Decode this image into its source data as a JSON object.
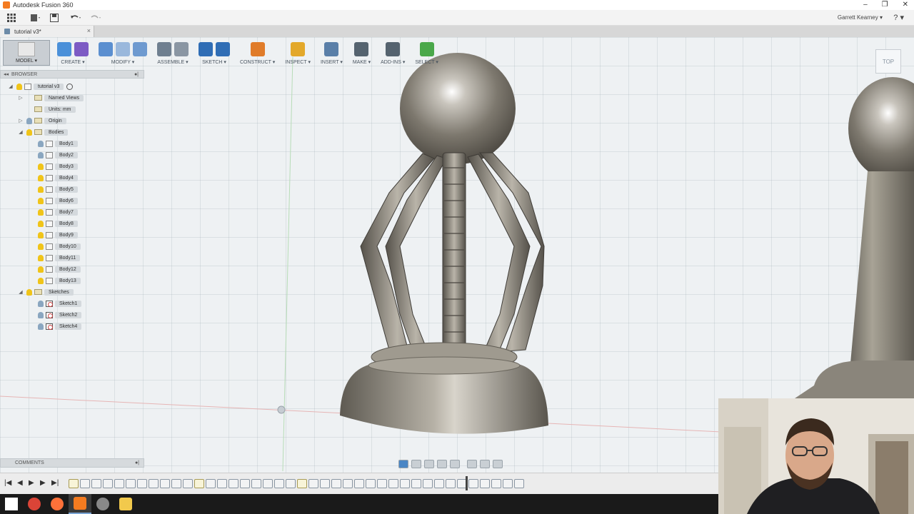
{
  "window": {
    "title": "Autodesk Fusion 360",
    "controls": [
      "–",
      "❐",
      "✕"
    ]
  },
  "quick_access": {
    "grid_icon": "apps-grid-icon",
    "file_icon": "file-icon",
    "save_icon": "save-icon",
    "undo_icon": "undo-icon",
    "redo_icon": "redo-icon",
    "user": "Garrett Kearney ▾",
    "help": "? ▾"
  },
  "document_tab": {
    "label": "tutorial v3*",
    "close": "×"
  },
  "toolbar": {
    "workspace": "MODEL ▾",
    "groups": [
      {
        "label": "CREATE ▾",
        "colors": [
          "#4a90d9",
          "#7d5bc4"
        ]
      },
      {
        "label": "MODIFY ▾",
        "colors": [
          "#5b8fd0",
          "#9ab8dc",
          "#6e9ad0"
        ]
      },
      {
        "label": "ASSEMBLE ▾",
        "colors": [
          "#6f7f90",
          "#8a96a3"
        ]
      },
      {
        "label": "SKETCH ▾",
        "colors": [
          "#2f6db5",
          "#2f6db5"
        ]
      },
      {
        "label": "CONSTRUCT ▾",
        "colors": [
          "#e07c2a"
        ]
      },
      {
        "label": "INSPECT ▾",
        "colors": [
          "#e3a82a"
        ]
      },
      {
        "label": "INSERT ▾",
        "colors": [
          "#5a7fa8"
        ]
      },
      {
        "label": "MAKE ▾",
        "colors": [
          "#55636f"
        ]
      },
      {
        "label": "ADD-INS ▾",
        "colors": [
          "#55636f"
        ]
      },
      {
        "label": "SELECT ▾",
        "colors": [
          "#4aa84a"
        ]
      }
    ]
  },
  "browser": {
    "title": "BROWSER",
    "root": "tutorial v3",
    "items": [
      {
        "label": "Named Views",
        "type": "folder",
        "indent": 1,
        "twisty": "▷"
      },
      {
        "label": "Units: mm",
        "type": "unit",
        "indent": 1,
        "twisty": ""
      },
      {
        "label": "Origin",
        "type": "folder",
        "indent": 1,
        "twisty": "▷",
        "bulb": "off"
      },
      {
        "label": "Bodies",
        "type": "folder",
        "indent": 1,
        "twisty": "◢",
        "bulb": "on"
      },
      {
        "label": "Body1",
        "type": "body",
        "indent": 2,
        "bulb": "off"
      },
      {
        "label": "Body2",
        "type": "body",
        "indent": 2,
        "bulb": "off"
      },
      {
        "label": "Body3",
        "type": "body",
        "indent": 2,
        "bulb": "on"
      },
      {
        "label": "Body4",
        "type": "body",
        "indent": 2,
        "bulb": "on"
      },
      {
        "label": "Body5",
        "type": "body",
        "indent": 2,
        "bulb": "on"
      },
      {
        "label": "Body6",
        "type": "body",
        "indent": 2,
        "bulb": "on"
      },
      {
        "label": "Body7",
        "type": "body",
        "indent": 2,
        "bulb": "on"
      },
      {
        "label": "Body8",
        "type": "body",
        "indent": 2,
        "bulb": "on"
      },
      {
        "label": "Body9",
        "type": "body",
        "indent": 2,
        "bulb": "on"
      },
      {
        "label": "Body10",
        "type": "body",
        "indent": 2,
        "bulb": "on"
      },
      {
        "label": "Body11",
        "type": "body",
        "indent": 2,
        "bulb": "on"
      },
      {
        "label": "Body12",
        "type": "body",
        "indent": 2,
        "bulb": "on"
      },
      {
        "label": "Body13",
        "type": "body",
        "indent": 2,
        "bulb": "on"
      },
      {
        "label": "Sketches",
        "type": "folder",
        "indent": 1,
        "twisty": "◢",
        "bulb": "on"
      },
      {
        "label": "Sketch1",
        "type": "sketch",
        "indent": 2,
        "bulb": "off"
      },
      {
        "label": "Sketch2",
        "type": "sketch",
        "indent": 2,
        "bulb": "off"
      },
      {
        "label": "Sketch4",
        "type": "sketch",
        "indent": 2,
        "bulb": "off"
      }
    ]
  },
  "viewcube": {
    "face": "TOP"
  },
  "comments": {
    "title": "COMMENTS"
  },
  "timeline": {
    "controls": [
      "|◀",
      "◀",
      "▶",
      "▶",
      "▶|"
    ],
    "feature_kinds": [
      "sk",
      "f",
      "f",
      "f",
      "f",
      "f",
      "f",
      "f",
      "f",
      "f",
      "f",
      "sk",
      "f",
      "f",
      "f",
      "f",
      "f",
      "f",
      "f",
      "f",
      "sk",
      "f",
      "f",
      "f",
      "f",
      "f",
      "f",
      "f",
      "f",
      "f",
      "f",
      "f",
      "f",
      "f",
      "f",
      "f",
      "f",
      "f",
      "f",
      "f"
    ]
  },
  "taskbar": {
    "items": [
      {
        "name": "windows-start-icon",
        "color": "#ffffff"
      },
      {
        "name": "chrome-icon",
        "color": "#db4437"
      },
      {
        "name": "firefox-icon",
        "color": "#ff7139"
      },
      {
        "name": "fusion-icon",
        "color": "#f47b20"
      },
      {
        "name": "clock-app-icon",
        "color": "#888888"
      },
      {
        "name": "folder-icon",
        "color": "#f2c94c"
      }
    ]
  }
}
